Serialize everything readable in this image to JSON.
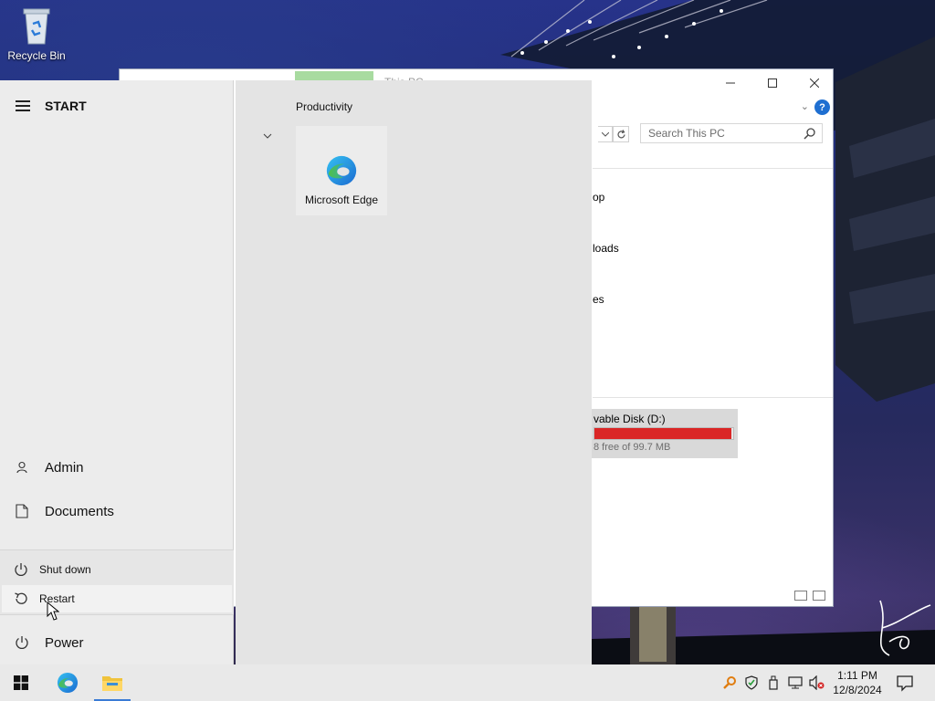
{
  "desktop": {
    "recycle_bin_label": "Recycle Bin"
  },
  "explorer": {
    "title": "This PC",
    "search_placeholder": "Search This PC",
    "nav_items": [
      "op",
      "loads",
      "es"
    ],
    "drive": {
      "name": "vable Disk (D:)",
      "free_text": "8 free of 99.7 MB",
      "used_fraction": 0.99,
      "bar_color": "#da2626"
    },
    "help_label": "?"
  },
  "start_menu": {
    "title": "START",
    "user": "Admin",
    "documents": "Documents",
    "power_options": {
      "shutdown": "Shut down",
      "restart": "Restart"
    },
    "power": "Power",
    "group_title": "Productivity",
    "tiles": [
      {
        "label": "Microsoft Edge",
        "icon": "edge-icon"
      }
    ]
  },
  "taskbar": {
    "time": "1:11 PM",
    "date": "12/8/2024",
    "accent": "#3a7bd5"
  }
}
